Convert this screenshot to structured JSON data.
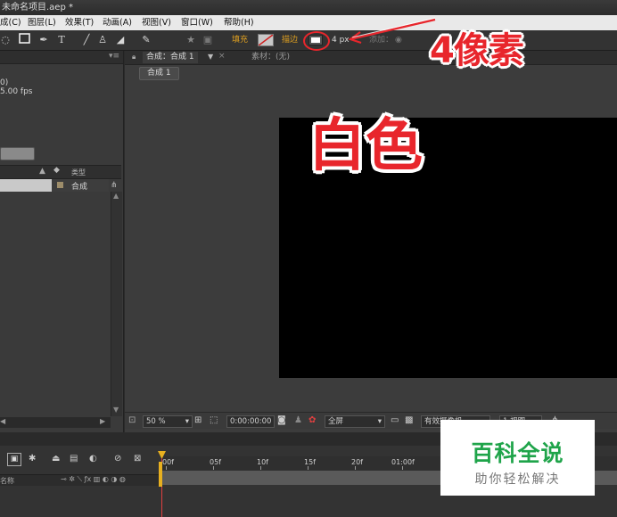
{
  "title": {
    "text": "未命名项目.aep *"
  },
  "menu": [
    {
      "label": "成(C)"
    },
    {
      "label": "图层(L)"
    },
    {
      "label": "效果(T)"
    },
    {
      "label": "动画(A)"
    },
    {
      "label": "视图(V)"
    },
    {
      "label": "窗口(W)"
    },
    {
      "label": "帮助(H)"
    }
  ],
  "toolbar": {
    "fill_label": "填充",
    "stroke_label": "描边",
    "stroke_width": "4 px",
    "add_label": "添加："
  },
  "left_panel": {
    "info_line1": "0)",
    "info_line2": "5.00 fps",
    "col_type": "类型",
    "item_type": "合成"
  },
  "viewer": {
    "comp_tab": "合成：合成 1",
    "footage_tab": "素材：(无)",
    "comp_button": "合成 1",
    "zoom": "50 %",
    "timecode": "0:00:00:00",
    "resolution": "全屏",
    "camera": "有效摄像机",
    "views": "1 视图"
  },
  "timeline": {
    "layer_col": "名称",
    "ruler": [
      "00f",
      "05f",
      "10f",
      "15f",
      "20f",
      "01:00f"
    ]
  },
  "annotations": {
    "px_note": "4像素",
    "color_note": "白色"
  },
  "watermark": {
    "title": "百科全说",
    "subtitle": "助你轻松解决"
  },
  "colors": {
    "annotation": "#e8262c",
    "canvas": "#000000",
    "watermark_green": "#1fa44a"
  }
}
